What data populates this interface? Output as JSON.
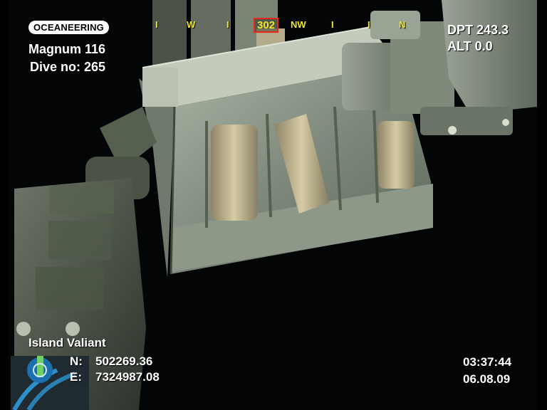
{
  "overlay": {
    "logo_text": "OCEANEERING",
    "vehicle": "Magnum 116",
    "dive": "Dive no: 265",
    "heading_value": "302",
    "compass_marks": [
      "I",
      "W",
      "I",
      "NW",
      "I",
      "I",
      "N"
    ],
    "depth": "DPT 243.3",
    "altitude": "ALT  0.0",
    "vessel": "Island Valiant",
    "north_label": "N:",
    "north_value": "502269.36",
    "east_label": "E:",
    "east_value": "7324987.08",
    "time": "03:37:44",
    "date": "06.08.09"
  },
  "colors": {
    "osd_text": "#ffffff",
    "compass_text": "#f2e62a",
    "heading_box": "#e8261a",
    "water": "#030506",
    "metal": "#9ea79a",
    "cylinders": "#c8bd94"
  }
}
